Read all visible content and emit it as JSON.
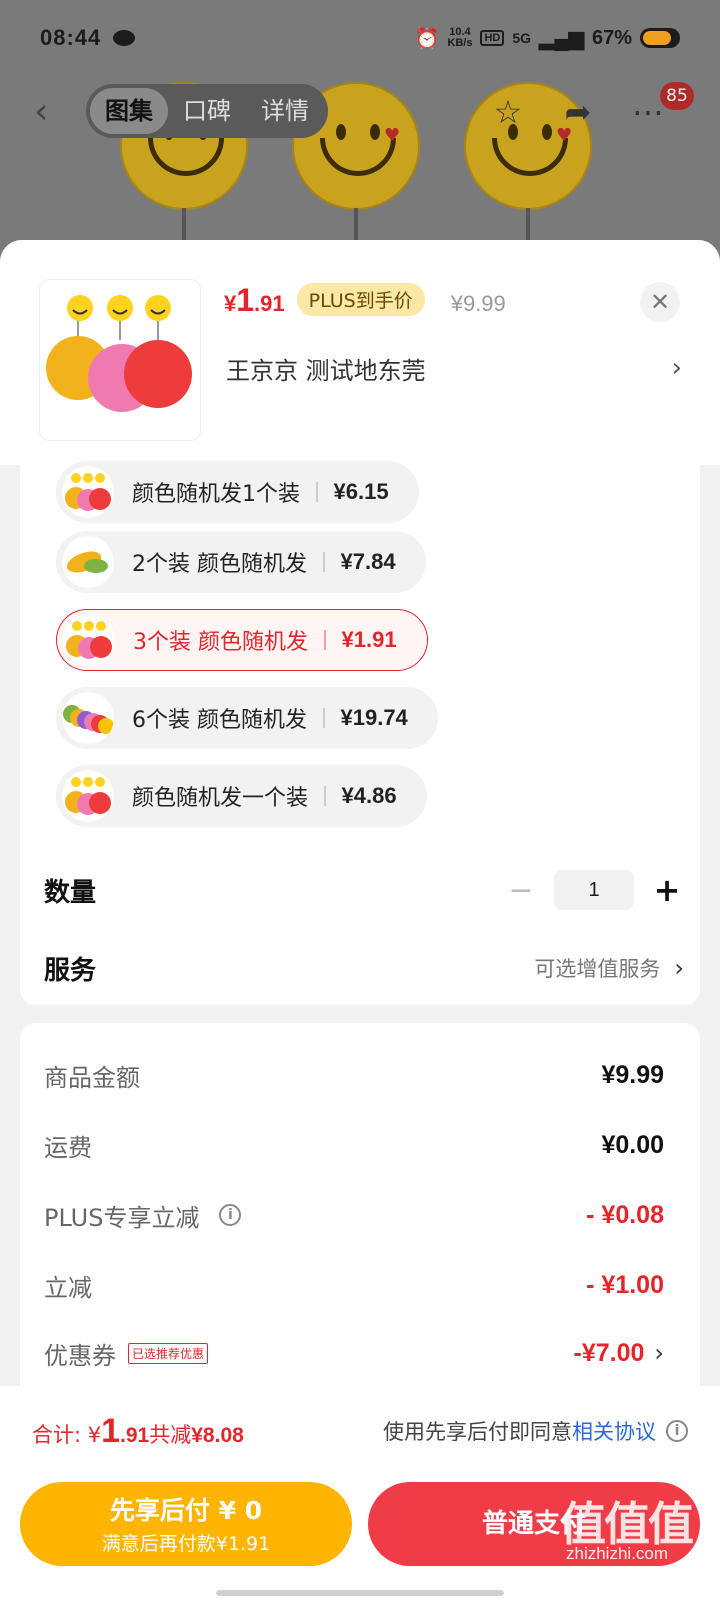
{
  "status_bar": {
    "time": "08:44",
    "speed_top": "10.4",
    "speed_unit": "KB/s",
    "hd": "HD",
    "signal": "5G",
    "battery": "67%"
  },
  "nav": {
    "tabs": [
      {
        "label": "图集",
        "active": true
      },
      {
        "label": "口碑",
        "active": false
      },
      {
        "label": "详情",
        "active": false
      }
    ],
    "badge_count": "85"
  },
  "sheet": {
    "price": {
      "symbol": "¥",
      "integer": "1",
      "decimal": ".91"
    },
    "plus_badge": "PLUS到手价",
    "original_price": "¥9.99",
    "address": "王京京  测试地东莞",
    "variants": [
      {
        "label": "颜色随机发1个装",
        "price": "¥6.15",
        "selected": false,
        "thumb": "three-smiley"
      },
      {
        "label": "2个装 颜色随机发",
        "price": "¥7.84",
        "selected": false,
        "thumb": "yellow-sponge"
      },
      {
        "label": "3个装 颜色随机发",
        "price": "¥1.91",
        "selected": true,
        "thumb": "three-smiley"
      },
      {
        "label": "6个装  颜色随机发",
        "price": "¥19.74",
        "selected": false,
        "thumb": "six-colors"
      },
      {
        "label": "颜色随机发一个装",
        "price": "¥4.86",
        "selected": false,
        "thumb": "three-smiley"
      }
    ],
    "quantity_label": "数量",
    "quantity_value": "1",
    "service_label": "服务",
    "service_hint": "可选增值服务"
  },
  "summary": {
    "goods_label": "商品金额",
    "goods_value": "¥9.99",
    "shipping_label": "运费",
    "shipping_value": "¥0.00",
    "plus_label": "PLUS专享立减",
    "plus_value": "- ¥0.08",
    "discount_label": "立减",
    "discount_value": "- ¥1.00",
    "coupon_label": "优惠券",
    "coupon_tag": "已选推荐优惠",
    "coupon_value": "-¥7.00"
  },
  "footer": {
    "total_prefix": "合计: ¥",
    "total_int": "1",
    "total_dec": ".91",
    "total_saved_label": " 共减",
    "total_saved": "¥8.08",
    "agree_text": "使用先享后付即同意",
    "agree_link": "相关协议",
    "later_line1": "先享后付 ¥ 0",
    "later_line2": "满意后再付款¥1.91",
    "normal_pay": "普通支付",
    "watermark": "值值值",
    "watermark_sub": "zhizhizhi.com"
  },
  "colors": {
    "accent_red": "#e4252a",
    "pay_later": "#ffb400",
    "pay_normal": "#f03c46",
    "link_blue": "#2a6ad8"
  }
}
